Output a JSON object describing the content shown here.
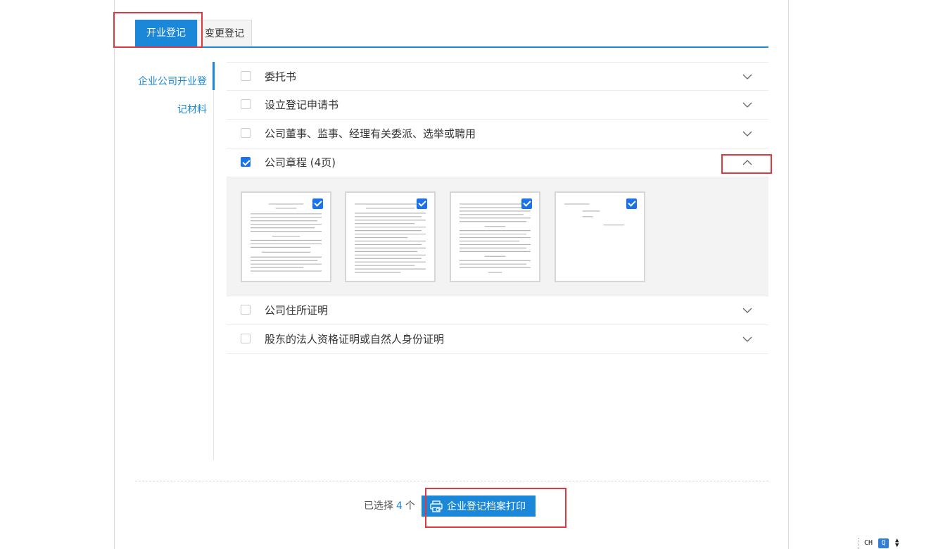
{
  "tabs": [
    {
      "label": "开业登记",
      "active": true
    },
    {
      "label": "变更登记",
      "active": false
    }
  ],
  "sidebar": {
    "items": [
      {
        "label": "企业公司开业登记材料",
        "active": true
      }
    ]
  },
  "documents": [
    {
      "label": "委托书",
      "checked": false,
      "expanded": false
    },
    {
      "label": "设立登记申请书",
      "checked": false,
      "expanded": false
    },
    {
      "label": "公司董事、监事、经理有关委派、选举或聘用",
      "checked": false,
      "expanded": false
    },
    {
      "label": "公司章程 (4页)",
      "checked": true,
      "expanded": true,
      "pages": [
        {
          "checked": true
        },
        {
          "checked": true
        },
        {
          "checked": true
        },
        {
          "checked": true
        }
      ]
    },
    {
      "label": "公司住所证明",
      "checked": false,
      "expanded": false
    },
    {
      "label": "股东的法人资格证明或自然人身份证明",
      "checked": false,
      "expanded": false
    }
  ],
  "footer": {
    "selected_prefix": "已选择",
    "selected_count": "4",
    "selected_suffix": "个",
    "print_label": "企业登记档案打印"
  },
  "ime": {
    "lang": "CH",
    "mode": "Q"
  },
  "colors": {
    "accent": "#1a87d8",
    "highlight": "#e0383e",
    "checkbox": "#1a73e8"
  },
  "icons": {
    "chevron_down": "chevron-down-icon",
    "chevron_up": "chevron-up-icon",
    "print": "printer-icon"
  }
}
